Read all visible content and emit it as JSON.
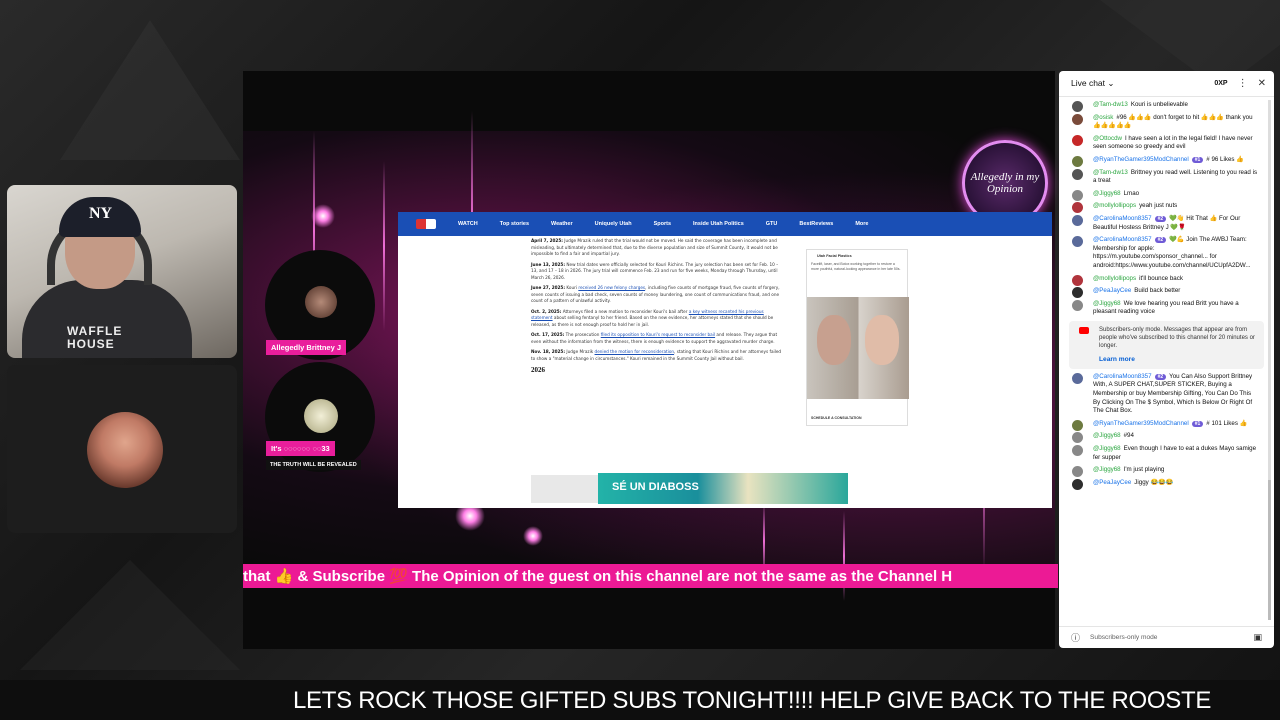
{
  "header_badge": "Allegedly in my Opinion",
  "host_tag": "Allegedly Brittney J",
  "guest_tag": "It's ◌◌◌◌◌◌ ◌◌33",
  "guest_sub": "THE TRUTH WILL BE REVEALED",
  "cam_shirt": "WAFFLE\nHOUSE",
  "browser": {
    "nav": [
      "WATCH",
      "Top stories",
      "Weather",
      "Uniquely Utah",
      "Sports",
      "Inside Utah Politics",
      "GTU",
      "BestReviews",
      "More"
    ],
    "p1_date": "April 7, 2025:",
    "p1": "Judge Mrazik ruled that the trial would not be moved. He said the coverage has been incomplete and misleading, but ultimately determined that, due to the diverse population and size of Summit County, it would not be impossible to find a fair and impartial jury.",
    "p2_date": "June 13, 2025:",
    "p2": "New trial dates were officially selected for Kouri Richins. The jury selection has been set for Feb. 10 – 13, and 17 – 18 in 2026. The jury trial will commence Feb. 23 and run for five weeks, Monday through Thursday, until March 26, 2026.",
    "p3_date": "June 27, 2025:",
    "p3_link": "received 26 new felony charges",
    "p3": "including five counts of mortgage fraud, five counts of forgery, seven counts of issuing a bad check, seven counts of money laundering, one count of communications fraud, and one count of a pattern of unlawful activity.",
    "p4_date": "Oct. 2, 2025:",
    "p4_pre": "Attorneys filed a new motion to reconsider Kouri's bail after",
    "p4_link": "a key witness recanted his previous statement",
    "p4": "about selling fentanyl to her friend. Based on the new evidence, her attorneys stated that she should be released, as there is not enough proof to hold her in jail.",
    "p5_date": "Oct. 17, 2025:",
    "p5_pre": "The prosecution",
    "p5_link": "filed its opposition to Kouri's request to reconsider bail",
    "p5": "and release. They argue that even without the information from the witness, there is enough evidence to support the aggravated murder charge.",
    "p6_date": "Nov. 18, 2025:",
    "p6_pre": "Judge Mrazik",
    "p6_link": "denied the motion for reconsideration",
    "p6": ", stating that Kouri Richins and her attorneys failed to show a \"material change in circumstances.\" Kouri remained in the Summit County Jail without bail.",
    "heading": "2026",
    "side_ad_title": "Utah Facial Plastics",
    "side_ad_desc": "Facelift, laser, and Botox working together to restore a more youthful, natural-looking appearance in her late 50s.",
    "side_ad_cta": "SCHEDULE A CONSULTATION",
    "banner_text": "SÉ UN DIABOSS"
  },
  "ticker": "that 👍 & Subscribe 💯 The Opinion of the guest on this channel are not the same as the Channel H",
  "marquee": "LETS ROCK THOSE GIFTED SUBS TONIGHT!!!! HELP GIVE BACK TO THE ROOSTE",
  "chat": {
    "title": "Live chat",
    "xp": "0XP",
    "messages": [
      {
        "author": "@Tam-dw13",
        "text": "Kouri is unbelievable",
        "color": "#555"
      },
      {
        "author": "@osisk",
        "text": "#96 👍👍👍 don't forget to hit 👍👍👍 thank you 👍👍👍👍👍",
        "color": "#7a4b3a"
      },
      {
        "author": "@Ottocdw",
        "text": "I have seen a lot in the legal field! I have never seen someone so greedy and evil",
        "color": "#c62828"
      },
      {
        "author": "@RyanTheGamer395ModChannel",
        "text": "# 96 Likes 👍",
        "color": "#6d7a40",
        "chip": "#1"
      },
      {
        "author": "@Tam-dw13",
        "text": "Brittney you read well. Listening to you read is a treat",
        "color": "#555"
      },
      {
        "author": "@Jiggy68",
        "text": "Lmao",
        "color": "#888"
      },
      {
        "author": "@mollylollipops",
        "text": "yeah just nuts",
        "color": "#b0343c"
      },
      {
        "author": "@CarolinaMoon8357",
        "text": "💚👋 Hit That 👍 For Our Beautiful Hostess Brittney J 💚🌹",
        "color": "#5a6a9a",
        "chip": "#2"
      },
      {
        "author": "@CarolinaMoon8357",
        "text": "💚💪 Join The AWBJ Team: Membership for apple: https://m.youtube.com/sponsor_channel... for android:https://www.youtube.com/channel/UCUpfA2DW...",
        "color": "#5a6a9a",
        "chip": "#2"
      },
      {
        "author": "@mollylollipops",
        "text": "it'll bounce back",
        "color": "#b0343c"
      },
      {
        "author": "@PeaJayCee",
        "text": "Build back better",
        "color": "#2d2d2d"
      },
      {
        "author": "@Jiggy68",
        "text": "We love hearing you read Britt you have a pleasant reading voice",
        "color": "#888"
      }
    ],
    "notice": "Subscribers-only mode. Messages that appear are from people who've subscribed to this channel for 20 minutes or longer.",
    "notice_link": "Learn more",
    "messages2": [
      {
        "author": "@CarolinaMoon8357",
        "text": "You Can Also Support Brittney With, A SUPER CHAT,SUPER STICKER, Buying a Membership or buy Membership Gifting, You Can Do This By Clicking On The $ Symbol, Which Is Below Or Right Of The Chat Box.",
        "color": "#5a6a9a",
        "chip": "#2"
      },
      {
        "author": "@RyanTheGamer395ModChannel",
        "text": "# 101 Likes 👍",
        "color": "#6d7a40",
        "chip": "#1"
      },
      {
        "author": "@Jiggy68",
        "text": "#94",
        "color": "#888"
      },
      {
        "author": "@Jiggy68",
        "text": "Even though I have to eat a dukes Mayo samige fer supper",
        "color": "#888"
      },
      {
        "author": "@Jiggy68",
        "text": "I'm just playing",
        "color": "#888"
      },
      {
        "author": "@PeaJayCee",
        "text": "Jiggy 😂😂😂",
        "color": "#2d2d2d"
      }
    ],
    "footer": "Subscribers-only mode"
  }
}
